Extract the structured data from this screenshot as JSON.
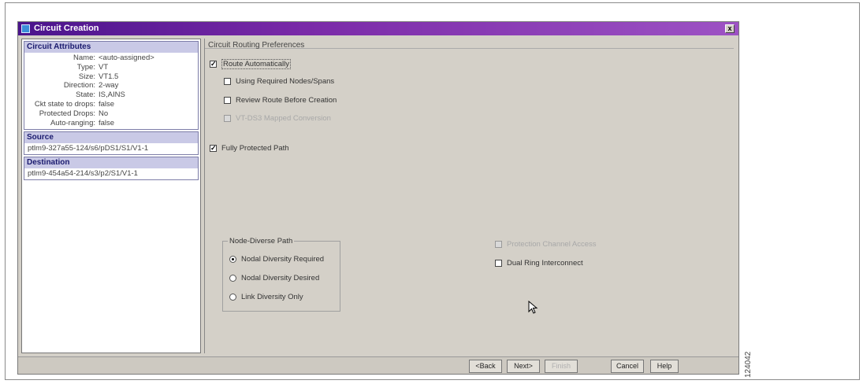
{
  "window": {
    "title": "Circuit Creation",
    "close_label": "x"
  },
  "attributes": {
    "title": "Circuit Attributes",
    "rows": [
      {
        "key": "Name:",
        "value": "<auto-assigned>"
      },
      {
        "key": "Type:",
        "value": "VT"
      },
      {
        "key": "Size:",
        "value": "VT1.5"
      },
      {
        "key": "Direction:",
        "value": "2-way"
      },
      {
        "key": "State:",
        "value": "IS,AINS"
      },
      {
        "key": "Ckt state to drops:",
        "value": "false"
      },
      {
        "key": "Protected Drops:",
        "value": "No"
      },
      {
        "key": "Auto-ranging:",
        "value": "false"
      }
    ]
  },
  "source": {
    "title": "Source",
    "path": "ptlm9-327a55-124/s6/pDS1/S1/V1-1"
  },
  "destination": {
    "title": "Destination",
    "path": "ptlm9-454a54-214/s3/p2/S1/V1-1"
  },
  "preferences": {
    "header": "Circuit Routing Preferences",
    "route_automatically": {
      "label": "Route Automatically",
      "checked": true
    },
    "using_required_nodes": {
      "label": "Using Required Nodes/Spans",
      "checked": false
    },
    "review_route": {
      "label": "Review Route Before Creation",
      "checked": false
    },
    "vt_ds3_mapped": {
      "label": "VT-DS3 Mapped Conversion",
      "checked": false,
      "disabled": true
    },
    "fully_protected": {
      "label": "Fully Protected Path",
      "checked": true
    },
    "node_diverse_title": "Node-Diverse Path",
    "radios": [
      {
        "label": "Nodal Diversity Required",
        "selected": true
      },
      {
        "label": "Nodal Diversity Desired",
        "selected": false
      },
      {
        "label": "Link Diversity Only",
        "selected": false
      }
    ],
    "protection_channel": {
      "label": "Protection Channel Access",
      "checked": false,
      "disabled": true
    },
    "dual_ring": {
      "label": "Dual Ring Interconnect",
      "checked": false
    }
  },
  "buttons": {
    "back": "<Back",
    "next": "Next>",
    "finish": "Finish",
    "cancel": "Cancel",
    "help": "Help"
  },
  "figure_number": "124042",
  "cursor_icon": "arrow-cursor-icon"
}
